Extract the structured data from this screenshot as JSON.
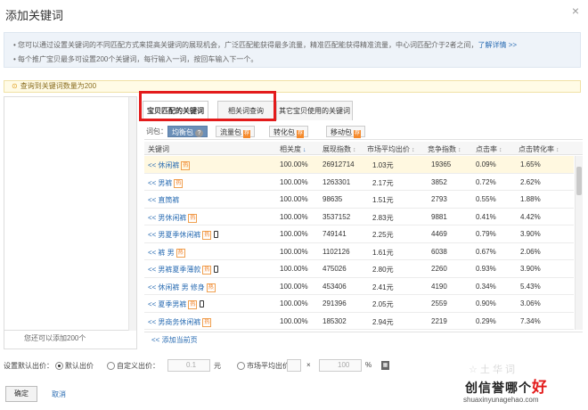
{
  "dialog": {
    "title": "添加关键词",
    "close": "×"
  },
  "info": {
    "line1": "您可以通过设置关键词的不同匹配方式来提高关键词的展现机会，广泛匹配能获得最多流量，精准匹配能获得精准流量，中心词匹配介于2者之间，",
    "link": "了解详情 >>",
    "line2": "每个推广宝贝最多可设置200个关键词，每行输入一词，按回车输入下一个。"
  },
  "warning": {
    "icon": "warning-icon",
    "text": "查询到关键词数量为200"
  },
  "left_panel": {
    "footer": "您还可以添加200个"
  },
  "tabs": [
    {
      "label": "宝贝匹配的关键词",
      "active": true
    },
    {
      "label": "相关词查询",
      "active": false
    },
    {
      "label": "其它宝贝使用的关键词",
      "active": false
    }
  ],
  "packages": {
    "label": "词包：",
    "items": [
      {
        "label": "均衡包",
        "selected": true,
        "help": "?"
      },
      {
        "label": "流量包",
        "tag": "荐"
      },
      {
        "label": "转化包",
        "tag": "荐"
      },
      {
        "label": "移动包",
        "tag": "荐"
      }
    ]
  },
  "grid": {
    "columns": [
      "关键词",
      "相关度",
      "展现指数",
      "市场平均出价",
      "竞争指数",
      "点击率",
      "点击转化率"
    ],
    "sort_active": "↓",
    "sort_idle": "↕",
    "rows": [
      {
        "kw": "休闲裤",
        "tag": "热",
        "phone": false,
        "rel": "100.00%",
        "imp": "26912714",
        "bid": "1.03元",
        "comp": "19365",
        "ctr": "0.09%",
        "cvr": "1.65%"
      },
      {
        "kw": "男裤",
        "tag": "热",
        "phone": false,
        "rel": "100.00%",
        "imp": "1263301",
        "bid": "2.17元",
        "comp": "3852",
        "ctr": "0.72%",
        "cvr": "2.62%"
      },
      {
        "kw": "直筒裤",
        "tag": "",
        "phone": false,
        "rel": "100.00%",
        "imp": "98635",
        "bid": "1.51元",
        "comp": "2793",
        "ctr": "0.55%",
        "cvr": "1.88%"
      },
      {
        "kw": "男休闲裤",
        "tag": "热",
        "phone": false,
        "rel": "100.00%",
        "imp": "3537152",
        "bid": "2.83元",
        "comp": "9881",
        "ctr": "0.41%",
        "cvr": "4.42%"
      },
      {
        "kw": "男夏季休闲裤",
        "tag": "热",
        "phone": true,
        "rel": "100.00%",
        "imp": "749141",
        "bid": "2.25元",
        "comp": "4469",
        "ctr": "0.79%",
        "cvr": "3.90%"
      },
      {
        "kw": "裤 男",
        "tag": "热",
        "phone": false,
        "rel": "100.00%",
        "imp": "1102126",
        "bid": "1.61元",
        "comp": "6038",
        "ctr": "0.67%",
        "cvr": "2.06%"
      },
      {
        "kw": "男裤夏季薄款",
        "tag": "热",
        "phone": true,
        "rel": "100.00%",
        "imp": "475026",
        "bid": "2.80元",
        "comp": "2260",
        "ctr": "0.93%",
        "cvr": "3.90%"
      },
      {
        "kw": "休闲裤 男 修身",
        "tag": "热",
        "phone": false,
        "rel": "100.00%",
        "imp": "453406",
        "bid": "2.41元",
        "comp": "4190",
        "ctr": "0.34%",
        "cvr": "5.43%"
      },
      {
        "kw": "夏季男裤",
        "tag": "热",
        "phone": true,
        "rel": "100.00%",
        "imp": "291396",
        "bid": "2.05元",
        "comp": "2559",
        "ctr": "0.90%",
        "cvr": "3.06%"
      },
      {
        "kw": "男商务休闲裤",
        "tag": "热",
        "phone": false,
        "rel": "100.00%",
        "imp": "185302",
        "bid": "2.94元",
        "comp": "2219",
        "ctr": "0.29%",
        "cvr": "7.34%"
      }
    ],
    "row_prefix": "<<",
    "add_all": "<< 添加当前页"
  },
  "bid": {
    "label": "设置默认出价：",
    "options": [
      "默认出价",
      "自定义出价：",
      "市场平均出价"
    ],
    "custom_value": "0.1",
    "unit_yuan": "元",
    "times": "×",
    "percent_value": "100",
    "percent": "%"
  },
  "buttons": {
    "ok": "确定",
    "cancel": "取消"
  },
  "watermark": {
    "faint": "☆ 土 华 词",
    "big_a": "创信誉哪个",
    "big_b": "好",
    "url": "shuaxinyunagehao.com"
  }
}
